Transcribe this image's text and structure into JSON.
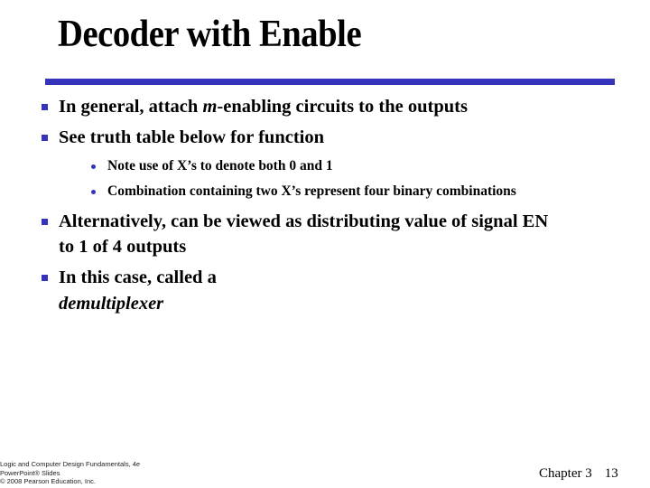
{
  "slide": {
    "title": "Decoder with Enable",
    "bullets": [
      {
        "pre": "In general, attach ",
        "em": "m",
        "post": "-enabling circuits to the outputs"
      },
      {
        "text": "See truth table below for function"
      },
      {
        "text": "Alternatively, can be viewed as distributing value of signal EN",
        "cont": "to 1 of 4 outputs"
      },
      {
        "text": "In this case, called a",
        "cont_em": "demultiplexer"
      }
    ],
    "sub_bullets": [
      "Note use of X’s to denote both 0 and 1",
      "Combination containing two X’s represent four binary combinations"
    ],
    "accent_color": "#3333bb"
  },
  "footer": {
    "book_line1": "Logic and Computer Design Fundamentals, 4e",
    "book_line2": "PowerPoint® Slides",
    "book_line3": "© 2008 Pearson Education, Inc.",
    "chapter": "Chapter 3",
    "page": "13"
  }
}
